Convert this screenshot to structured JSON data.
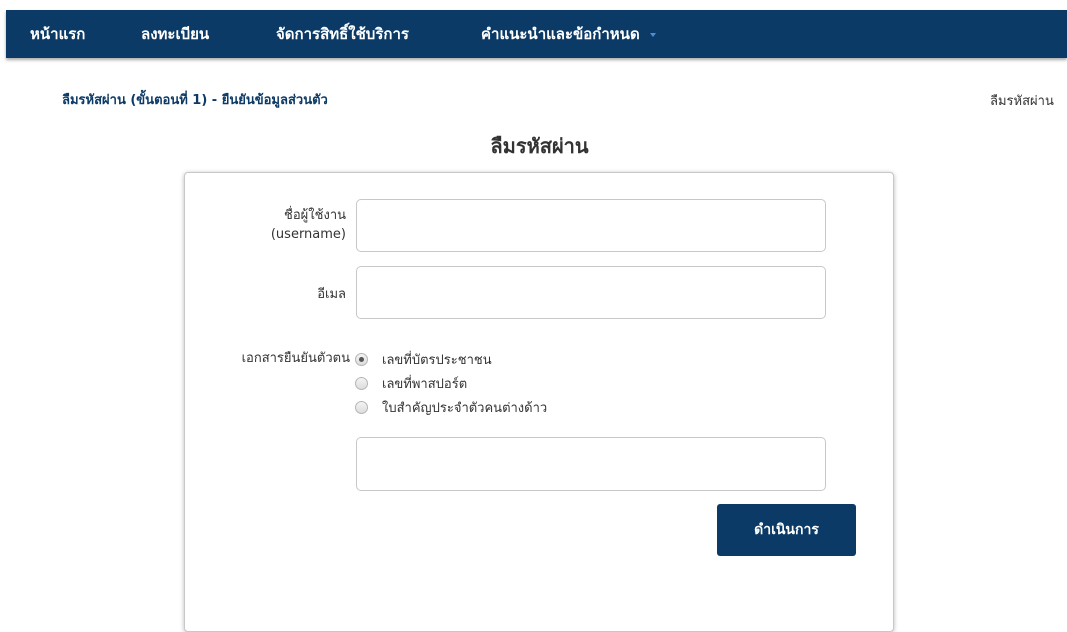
{
  "nav": {
    "items": [
      {
        "label": "หน้าแรก"
      },
      {
        "label": "ลงทะเบียน"
      },
      {
        "label": "จัดการสิทธิ์ใช้บริการ"
      },
      {
        "label": "คำแนะนำและข้อกำหนด",
        "has_dropdown": true
      }
    ],
    "background": "#0c3a66"
  },
  "breadcrumb": {
    "text": "ลืมรหัสผ่าน (ขั้นตอนที่ 1) - ยืนยันข้อมูลส่วนตัว",
    "right_text": "ลืมรหัสผ่าน"
  },
  "page_title": "ลืมรหัสผ่าน",
  "form": {
    "username_label_line1": "ชื่อผู้ใช้งาน",
    "username_label_line2": "(username)",
    "username_value": "",
    "email_label": "อีเมล",
    "email_value": "",
    "id_doc_label": "เอกสารยืนยันตัวตน",
    "id_doc_options": [
      {
        "label": "เลขที่บัตรประชาชน",
        "selected": true
      },
      {
        "label": "เลขที่พาสปอร์ต",
        "selected": false
      },
      {
        "label": "ใบสำคัญประจำตัวคนต่างด้าว",
        "selected": false
      }
    ],
    "id_number_value": "",
    "submit_label": "ดำเนินการ"
  },
  "accent_color": "#0c3a66"
}
